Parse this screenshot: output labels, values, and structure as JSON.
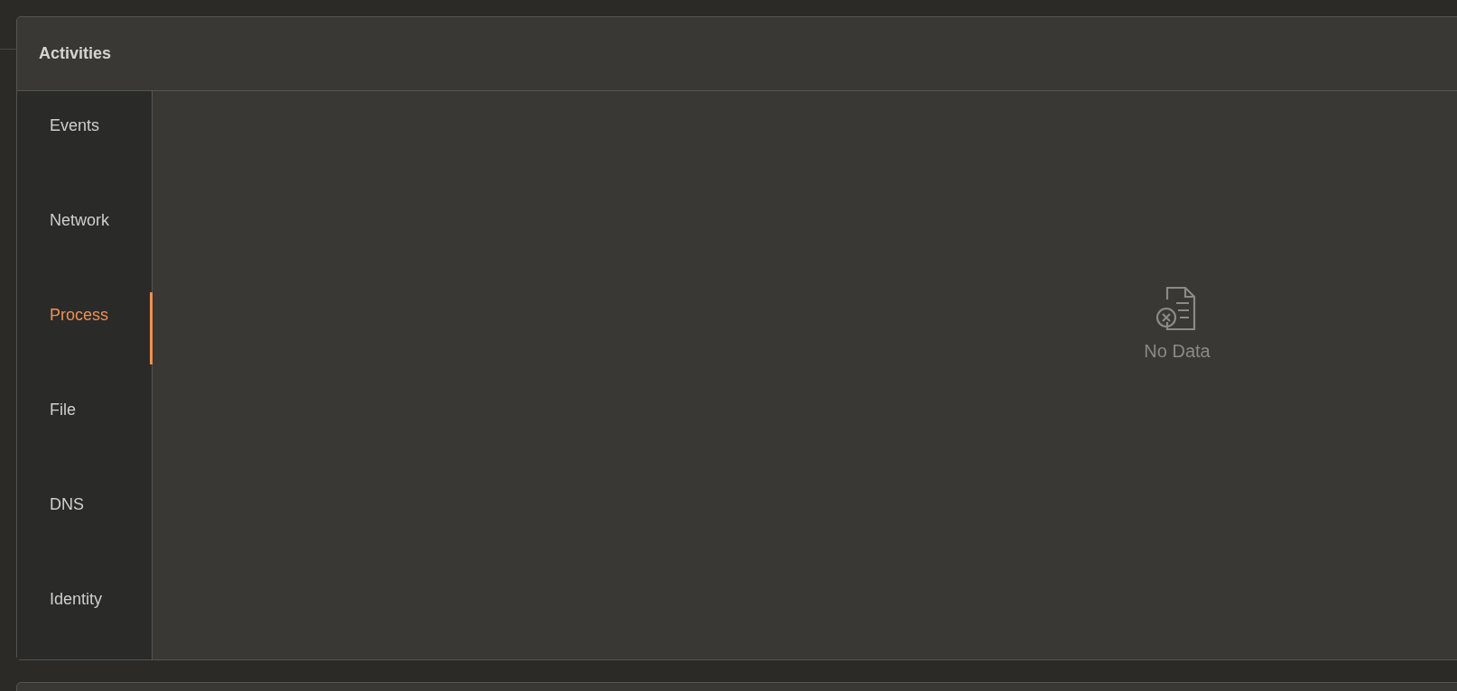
{
  "panel": {
    "title": "Activities"
  },
  "tabs": [
    {
      "label": "Events",
      "selected": false
    },
    {
      "label": "Network",
      "selected": false
    },
    {
      "label": "Process",
      "selected": true
    },
    {
      "label": "File",
      "selected": false
    },
    {
      "label": "DNS",
      "selected": false
    },
    {
      "label": "Identity",
      "selected": false
    }
  ],
  "empty_state": {
    "message": "No Data"
  }
}
